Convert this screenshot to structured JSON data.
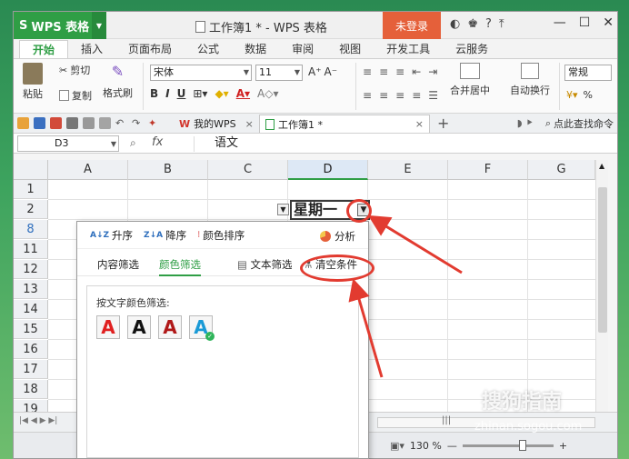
{
  "titlebar": {
    "app_name": "WPS 表格",
    "doc_title": "工作簿1 * - WPS 表格",
    "login": "未登录",
    "help": "?"
  },
  "menu": {
    "tabs": [
      "开始",
      "插入",
      "页面布局",
      "公式",
      "数据",
      "审阅",
      "视图",
      "开发工具",
      "云服务"
    ]
  },
  "ribbon": {
    "paste": "粘贴",
    "cut": "剪切",
    "copy": "复制",
    "format_painter": "格式刷",
    "font_name": "宋体",
    "font_size": "11",
    "bold": "B",
    "italic": "I",
    "underline": "U",
    "merge_center": "合并居中",
    "wrap_text": "自动换行",
    "number_format": "常规",
    "percent": "%"
  },
  "quickbar": {
    "tab_mywps": "我的WPS",
    "tab_workbook": "工作簿1 *",
    "find": "点此查找命令"
  },
  "formula": {
    "name_box": "D3",
    "fx": "fx",
    "content": "语文"
  },
  "grid": {
    "columns": [
      "A",
      "B",
      "C",
      "D",
      "E",
      "F",
      "G"
    ],
    "rows": [
      "1",
      "2",
      "8",
      "11",
      "12",
      "13",
      "14",
      "15",
      "16",
      "17",
      "18",
      "19"
    ],
    "cell_d2": "星期一"
  },
  "filter_popup": {
    "asc": "升序",
    "desc": "降序",
    "color_sort": "颜色排序",
    "analyze": "分析",
    "tab_content": "内容筛选",
    "tab_color": "颜色筛选",
    "tab_text": "文本筛选",
    "clear": "清空条件",
    "by_font_color": "按文字颜色筛选:",
    "swatch_letter": "A",
    "swatch_colors": [
      "#e02020",
      "#111111",
      "#b01818",
      "#1a9ad6"
    ]
  },
  "status": {
    "zoom": "130 %"
  },
  "watermark": {
    "brand": "搜狗指南",
    "url": "zhinan.sogou.com"
  },
  "colors": {
    "accent_green": "#2f9e45",
    "login_orange": "#e5603a",
    "annotation_red": "#e23b30"
  }
}
